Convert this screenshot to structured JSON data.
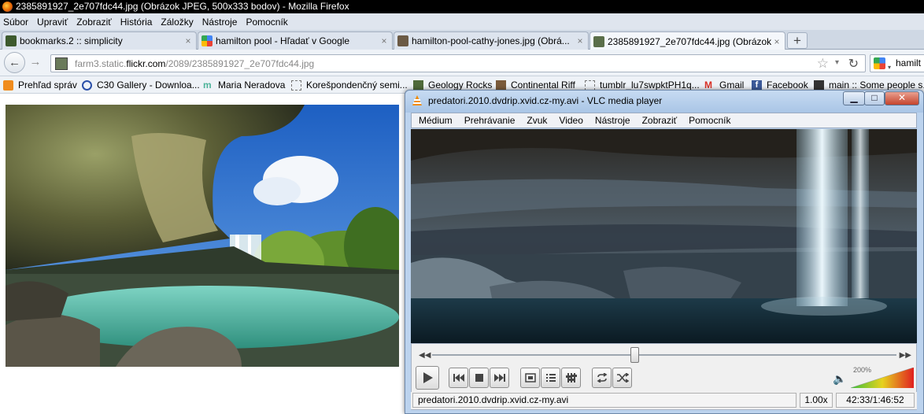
{
  "browser": {
    "title": "2385891927_2e707fdc44.jpg (Obrázok JPEG, 500x333 bodov) - Mozilla Firefox",
    "menu": [
      "Súbor",
      "Upraviť",
      "Zobraziť",
      "História",
      "Záložky",
      "Nástroje",
      "Pomocník"
    ],
    "tabs": [
      {
        "label": "bookmarks.2 :: simplicity",
        "close": "×",
        "active": false
      },
      {
        "label": "hamilton pool - Hľadať v Google",
        "close": "×",
        "active": false
      },
      {
        "label": "hamilton-pool-cathy-jones.jpg (Obrá...",
        "close": "×",
        "active": false
      },
      {
        "label": "2385891927_2e707fdc44.jpg (Obrázok ...",
        "close": "×",
        "active": true
      }
    ],
    "new_tab_label": "+",
    "nav": {
      "back": "←",
      "forward": "→",
      "reload": "↻",
      "star": "☆",
      "dropdown": "▾"
    },
    "url": {
      "prefix": "farm3.static.",
      "host": "flickr.com",
      "path": "/2089/2385891927_2e707fdc44.jpg"
    },
    "search": {
      "text": "hamilt",
      "arrow": "▾"
    },
    "bookmarks": [
      {
        "label": "Prehľad správ",
        "icon": "rss-icon"
      },
      {
        "label": "C30 Gallery - Downloa...",
        "icon": "c30-icon"
      },
      {
        "label": "Maria Neradova",
        "icon": "m-icon"
      },
      {
        "label": "Korešpondenčný semi...",
        "icon": "page-icon"
      },
      {
        "label": "Geology Rocks",
        "icon": "image-icon"
      },
      {
        "label": "Continental Riff",
        "icon": "image-icon"
      },
      {
        "label": "tumblr_lu7swpktPH1q...",
        "icon": "page-icon"
      },
      {
        "label": "Gmail",
        "icon": "gmail-icon"
      },
      {
        "label": "Facebook",
        "icon": "facebook-icon"
      },
      {
        "label": "main :: Some people s...",
        "icon": "image-icon"
      }
    ]
  },
  "vlc": {
    "title": "predatori.2010.dvdrip.xvid.cz-my.avi - VLC media player",
    "menu": [
      "Médium",
      "Prehrávanie",
      "Zvuk",
      "Video",
      "Nástroje",
      "Zobraziť",
      "Pomocník"
    ],
    "window_buttons": {
      "minimize": "▁",
      "maximize": "□",
      "close": "✕"
    },
    "seek": {
      "left": "◀◀",
      "right": "▶▶",
      "progress": 0.437
    },
    "volume_label": "200%",
    "volume_icon": "speaker-icon",
    "status": {
      "file": "predatori.2010.dvdrip.xvid.cz-my.avi",
      "speed": "1.00x",
      "time": "42:33/1:46:52"
    },
    "colors": {
      "volume_low": "#3cbf3c",
      "volume_mid": "#e6d21e",
      "volume_high": "#e02020"
    }
  }
}
